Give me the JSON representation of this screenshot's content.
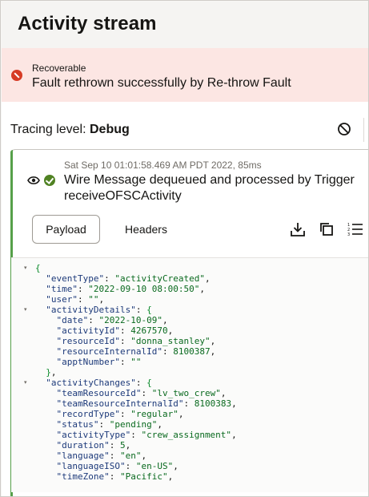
{
  "page": {
    "title": "Activity stream"
  },
  "banner": {
    "type": "Recoverable",
    "message": "Fault rethrown successfully by Re-throw Fault",
    "color": "#fce6e3",
    "icon": "error-icon"
  },
  "tracing": {
    "label": "Tracing level: ",
    "level": "Debug",
    "clear_icon": "clear-icon"
  },
  "activity": {
    "timestamp": "Sat Sep 10 01:01:58.469 AM PDT 2022, 85ms",
    "message": "Wire Message dequeued and processed by Trigger receiveOFSCActivity",
    "status_color": "#508223",
    "tabs": [
      {
        "label": "Payload",
        "selected": true
      },
      {
        "label": "Headers",
        "selected": false
      }
    ],
    "tools": [
      "download-icon",
      "copy-icon",
      "list-icon"
    ]
  },
  "payload": {
    "lines": [
      {
        "fold": true,
        "text": "{"
      },
      {
        "fold": false,
        "text": "  \"eventType\": \"activityCreated\","
      },
      {
        "fold": false,
        "text": "  \"time\": \"2022-09-10 08:00:50\","
      },
      {
        "fold": false,
        "text": "  \"user\": \"\","
      },
      {
        "fold": true,
        "text": "  \"activityDetails\": {"
      },
      {
        "fold": false,
        "text": "    \"date\": \"2022-10-09\","
      },
      {
        "fold": false,
        "text": "    \"activityId\": 4267570,"
      },
      {
        "fold": false,
        "text": "    \"resourceId\": \"donna_stanley\","
      },
      {
        "fold": false,
        "text": "    \"resourceInternalId\": 8100387,"
      },
      {
        "fold": false,
        "text": "    \"apptNumber\": \"\""
      },
      {
        "fold": false,
        "text": "  },"
      },
      {
        "fold": true,
        "text": "  \"activityChanges\": {"
      },
      {
        "fold": false,
        "text": "    \"teamResourceId\": \"lv_two_crew\","
      },
      {
        "fold": false,
        "text": "    \"teamResourceInternalId\": 8100383,"
      },
      {
        "fold": false,
        "text": "    \"recordType\": \"regular\","
      },
      {
        "fold": false,
        "text": "    \"status\": \"pending\","
      },
      {
        "fold": false,
        "text": "    \"activityType\": \"crew_assignment\","
      },
      {
        "fold": false,
        "text": "    \"duration\": 5,"
      },
      {
        "fold": false,
        "text": "    \"language\": \"en\","
      },
      {
        "fold": false,
        "text": "    \"languageISO\": \"en-US\","
      },
      {
        "fold": false,
        "text": "    \"timeZone\": \"Pacific\","
      }
    ]
  }
}
